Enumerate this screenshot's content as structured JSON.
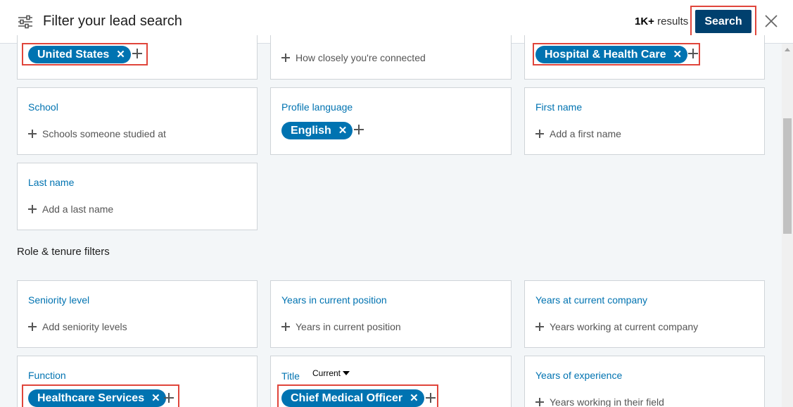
{
  "header": {
    "title": "Filter your lead search",
    "results_count": "1K+",
    "results_label": "results",
    "search_label": "Search"
  },
  "top_row": {
    "geography_pill": "United States",
    "connection_placeholder": "How closely you're connected",
    "industry_pill": "Hospital & Health Care"
  },
  "cards": {
    "school": {
      "label": "School",
      "placeholder": "Schools someone studied at"
    },
    "profile_language": {
      "label": "Profile language",
      "pill": "English"
    },
    "first_name": {
      "label": "First name",
      "placeholder": "Add a first name"
    },
    "last_name": {
      "label": "Last name",
      "placeholder": "Add a last name"
    }
  },
  "role_section": {
    "title": "Role & tenure filters",
    "seniority": {
      "label": "Seniority level",
      "placeholder": "Add seniority levels"
    },
    "years_position": {
      "label": "Years in current position",
      "placeholder": "Years in current position"
    },
    "years_company": {
      "label": "Years at current company",
      "placeholder": "Years working at current company"
    },
    "function": {
      "label": "Function",
      "pill": "Healthcare Services"
    },
    "title_filter": {
      "label": "Title",
      "dropdown": "Current",
      "pill": "Chief Medical Officer"
    },
    "years_experience": {
      "label": "Years of experience",
      "placeholder": "Years working in their field"
    }
  },
  "colors": {
    "accent": "#0073b1",
    "search_button": "#00406e",
    "highlight": "#e0453b"
  }
}
